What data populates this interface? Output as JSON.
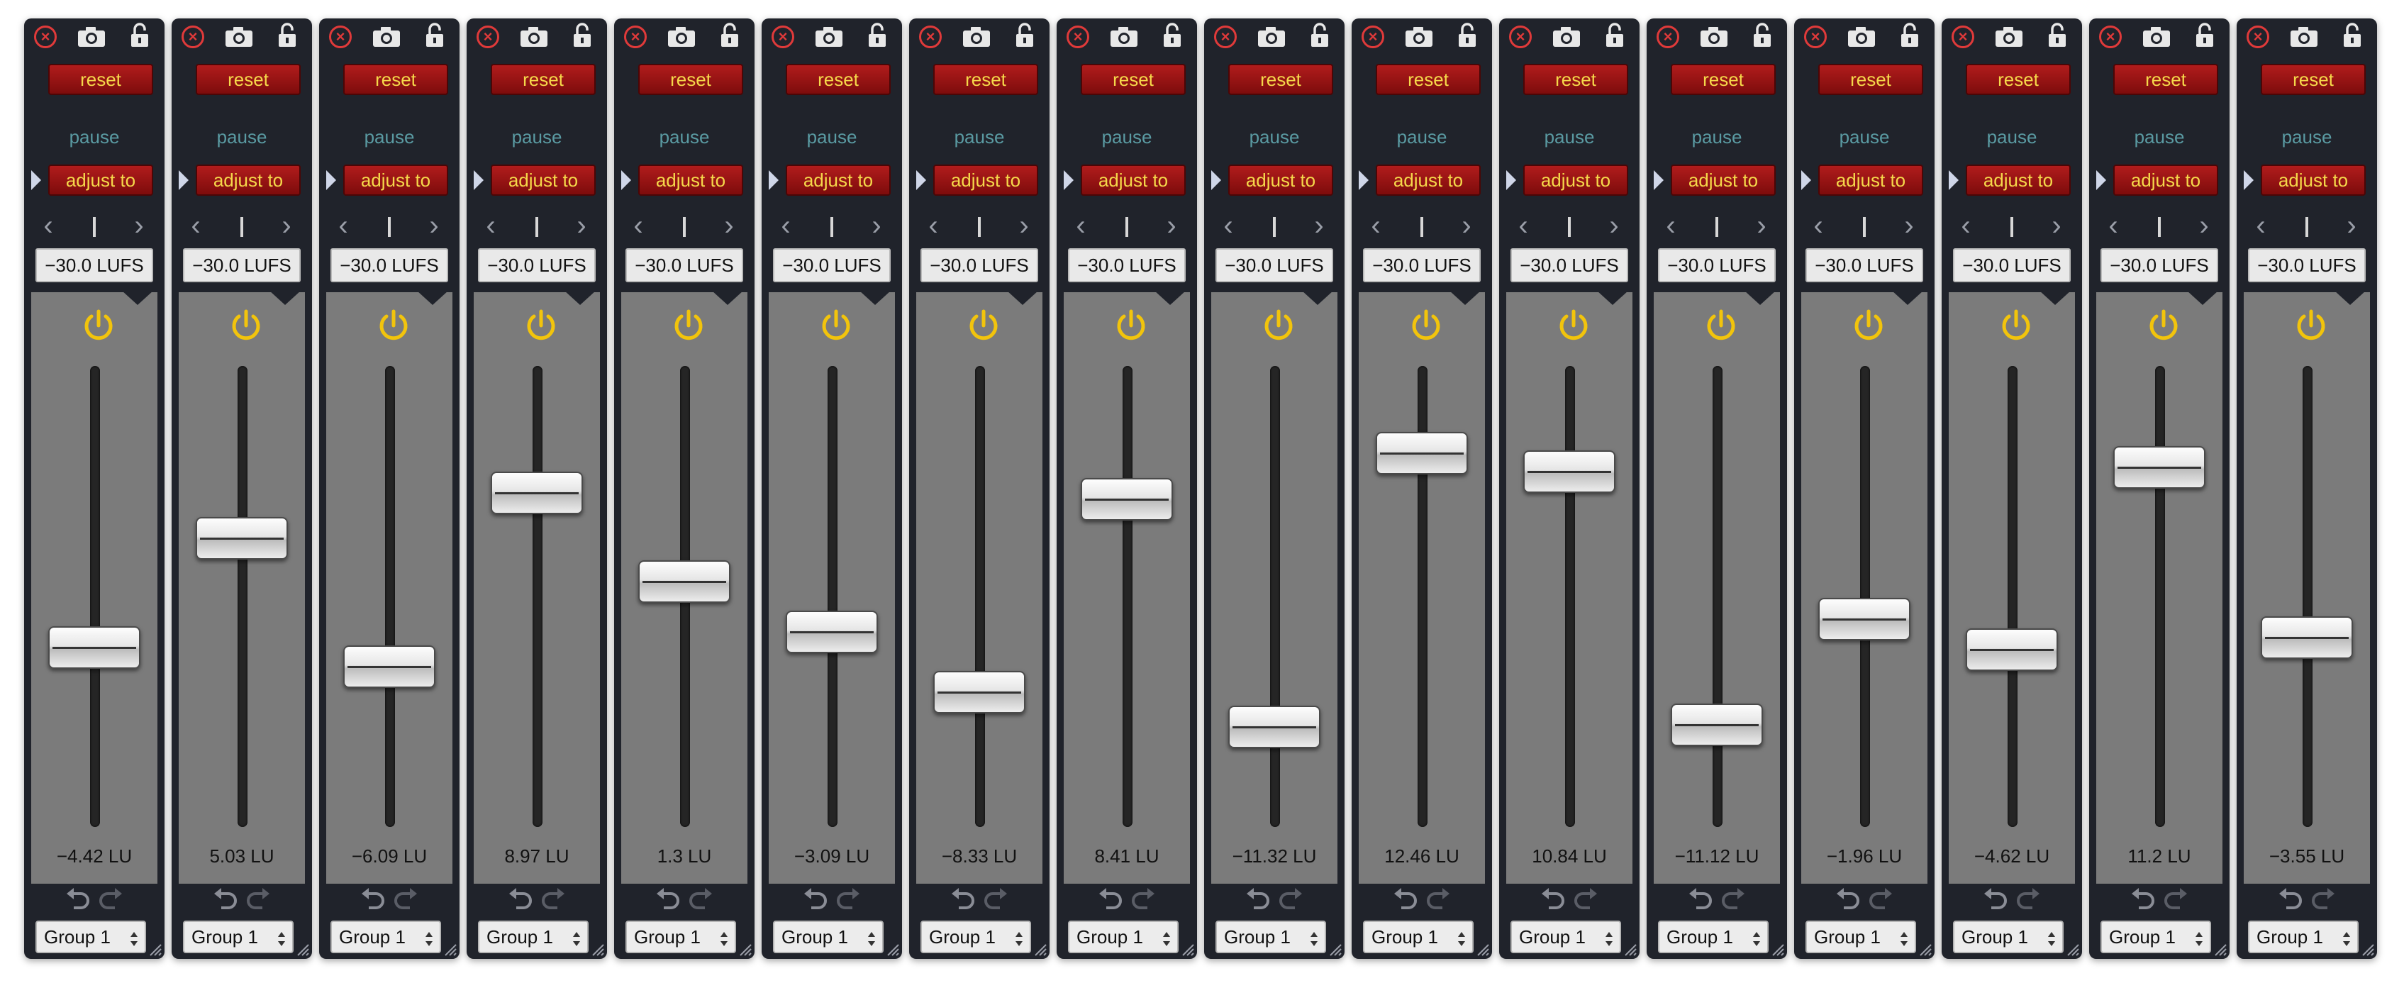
{
  "labels": {
    "reset": "reset",
    "pause": "pause",
    "adjust": "adjust to",
    "target": "−30.0 LUFS",
    "group": "Group 1"
  },
  "icons": [
    "close-icon",
    "camera-icon",
    "lock-icon",
    "chevron-left-icon",
    "chevron-right-icon",
    "power-icon",
    "undo-icon",
    "redo-icon",
    "select-arrows-icon",
    "resize-grip-icon"
  ],
  "colors": {
    "strip_bg": "#20232b",
    "panel_bg": "#7b7b7b",
    "button_red": "#9a1414",
    "button_text": "#f5d84a",
    "pause_text": "#5a9aa2",
    "power": "#f2c40c",
    "close": "#e03a3a"
  },
  "fader_range": [
    -20,
    20
  ],
  "channels": [
    {
      "value": -4.42,
      "readout": "−4.42 LU"
    },
    {
      "value": 5.03,
      "readout": "5.03 LU"
    },
    {
      "value": -6.09,
      "readout": "−6.09 LU"
    },
    {
      "value": 8.97,
      "readout": "8.97 LU"
    },
    {
      "value": 1.3,
      "readout": "1.3 LU"
    },
    {
      "value": -3.09,
      "readout": "−3.09 LU"
    },
    {
      "value": -8.33,
      "readout": "−8.33 LU"
    },
    {
      "value": 8.41,
      "readout": "8.41 LU"
    },
    {
      "value": -11.32,
      "readout": "−11.32 LU"
    },
    {
      "value": 12.46,
      "readout": "12.46 LU"
    },
    {
      "value": 10.84,
      "readout": "10.84 LU"
    },
    {
      "value": -11.12,
      "readout": "−11.12 LU"
    },
    {
      "value": -1.96,
      "readout": "−1.96 LU"
    },
    {
      "value": -4.62,
      "readout": "−4.62 LU"
    },
    {
      "value": 11.2,
      "readout": "11.2 LU"
    },
    {
      "value": -3.55,
      "readout": "−3.55 LU"
    }
  ]
}
